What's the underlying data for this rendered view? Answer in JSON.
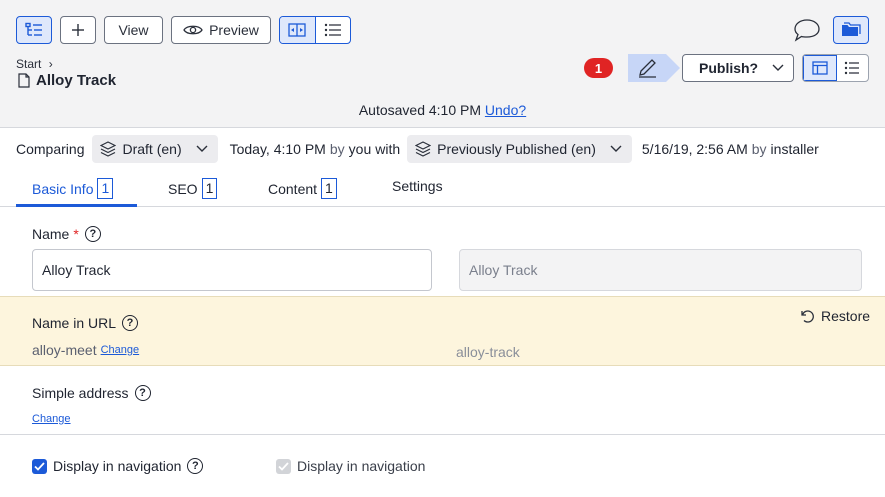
{
  "toolbar": {
    "view_label": "View",
    "preview_label": "Preview"
  },
  "breadcrumb": {
    "start": "Start"
  },
  "page": {
    "title": "Alloy Track"
  },
  "notifications": {
    "count": "1"
  },
  "publish": {
    "label": "Publish?"
  },
  "autosave": {
    "text": "Autosaved 4:10 PM",
    "undo": "Undo?"
  },
  "compare": {
    "prefix": "Comparing",
    "left_version": "Draft (en)",
    "left_date": "Today, 4:10 PM",
    "left_by": "by",
    "left_user": "you",
    "with": "with",
    "right_version": "Previously Published (en)",
    "right_date": "5/16/19, 2:56 AM",
    "right_by": "by",
    "right_user": "installer"
  },
  "tabs": [
    {
      "label": "Basic Info",
      "badge": "1"
    },
    {
      "label": "SEO",
      "badge": "1"
    },
    {
      "label": "Content",
      "badge": "1"
    },
    {
      "label": "Settings"
    }
  ],
  "fields": {
    "name": {
      "label": "Name",
      "required": "*",
      "value": "Alloy Track",
      "compare_value": "Alloy Track"
    },
    "url": {
      "label": "Name in URL",
      "value": "alloy-meet",
      "change": "Change",
      "compare_value": "alloy-track",
      "restore": "Restore"
    },
    "simple": {
      "label": "Simple address",
      "change": "Change"
    },
    "nav": {
      "label": "Display in navigation",
      "compare_label": "Display in navigation",
      "checked": true
    }
  },
  "colors": {
    "accent": "#1c5ad8",
    "notif": "#e02424",
    "changed_bg": "#fdf5dd"
  }
}
